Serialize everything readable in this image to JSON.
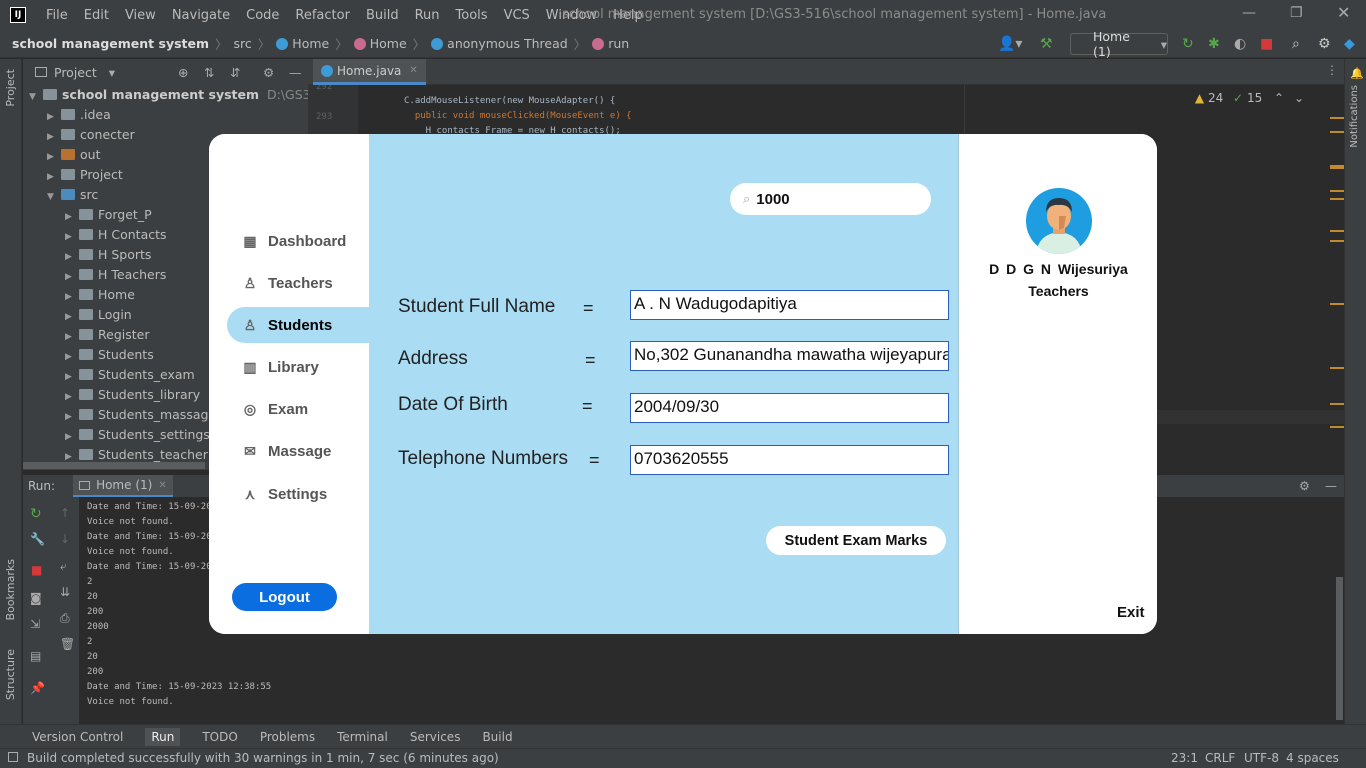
{
  "ide": {
    "logo": "IJ",
    "menu": [
      "File",
      "Edit",
      "View",
      "Navigate",
      "Code",
      "Refactor",
      "Build",
      "Run",
      "Tools",
      "VCS",
      "Window",
      "Help"
    ],
    "window_title": "school management system [D:\\GS3-516\\school management system] - Home.java",
    "breadcrumbs": [
      "school management system",
      "src",
      "Home",
      "Home",
      "anonymous Thread",
      "run"
    ],
    "run_config": "Home (1)",
    "project_label": "Project",
    "editor_tab": "Home.java",
    "warnings": "24",
    "weak_warnings": "15",
    "tree": [
      {
        "label": "school management system",
        "extra": "D:\\GS3-516\\sch",
        "level": 0,
        "open": true
      },
      {
        "label": ".idea",
        "level": 1
      },
      {
        "label": "conecter",
        "level": 1
      },
      {
        "label": "out",
        "level": 1
      },
      {
        "label": "Project",
        "level": 1
      },
      {
        "label": "src",
        "level": 1,
        "open": true
      },
      {
        "label": "Forget_P",
        "level": 2
      },
      {
        "label": "H Contacts",
        "level": 2
      },
      {
        "label": "H Sports",
        "level": 2
      },
      {
        "label": "H Teachers",
        "level": 2
      },
      {
        "label": "Home",
        "level": 2
      },
      {
        "label": "Login",
        "level": 2
      },
      {
        "label": "Register",
        "level": 2
      },
      {
        "label": "Students",
        "level": 2
      },
      {
        "label": "Students_exam",
        "level": 2
      },
      {
        "label": "Students_library",
        "level": 2
      },
      {
        "label": "Students_massage",
        "level": 2
      },
      {
        "label": "Students_settings",
        "level": 2
      },
      {
        "label": "Students_teacher",
        "level": 2
      }
    ],
    "code_lines": [
      {
        "num": "292",
        "text": "C.addMouseListener(new MouseAdapter() {"
      },
      {
        "num": "293",
        "text": "  public void mouseClicked(MouseEvent e) {"
      },
      {
        "num": "294",
        "text": "    H_contacts Frame = new H_contacts();"
      }
    ],
    "run_label": "Run:",
    "run_tab": "Home (1)",
    "console_lines": [
      "Date and Time: 15-09-202",
      "Voice not found.",
      "Date and Time: 15-09-202",
      "Voice not found.",
      "Date and Time: 15-09-202",
      "2",
      "20",
      "200",
      "2000",
      "2",
      "20",
      "200",
      "Date and Time: 15-09-2023 12:38:55",
      "Voice not found."
    ],
    "bottom_tools": [
      "Version Control",
      "Run",
      "TODO",
      "Problems",
      "Terminal",
      "Services",
      "Build"
    ],
    "status_message": "Build completed successfully with 30 warnings in 1 min, 7 sec (6 minutes ago)",
    "status_right": [
      "23:1",
      "CRLF",
      "UTF-8",
      "4 spaces"
    ],
    "left_strip": [
      "Project",
      "Bookmarks",
      "Structure"
    ],
    "right_strip": [
      "Notifications"
    ]
  },
  "app": {
    "nav": [
      {
        "label": "Dashboard",
        "icon": "dashboard-icon"
      },
      {
        "label": "Teachers",
        "icon": "teacher-icon"
      },
      {
        "label": "Students",
        "icon": "student-icon",
        "active": true
      },
      {
        "label": "Library",
        "icon": "library-icon"
      },
      {
        "label": "Exam",
        "icon": "exam-icon"
      },
      {
        "label": "Massage",
        "icon": "mail-icon"
      },
      {
        "label": "Settings",
        "icon": "settings-icon"
      }
    ],
    "logout": "Logout",
    "search_value": "1000",
    "fields": [
      {
        "label": "Student Full Name",
        "eq": "=",
        "value": "A . N Wadugodapitiya"
      },
      {
        "label": "Address",
        "eq": "=",
        "value": "No,302 Gunanandha mawatha wijeyapura"
      },
      {
        "label": "Date Of Birth",
        "eq": "=",
        "value": "2004/09/30"
      },
      {
        "label": "Telephone Numbers",
        "eq": "=",
        "value": "0703620555"
      }
    ],
    "exam_button": "Student Exam Marks",
    "user_name": "D D G N  Wijesuriya",
    "user_role": "Teachers",
    "exit": "Exit",
    "colors": {
      "main_bg": "#aadcf3",
      "logout_bg": "#0b6ee0",
      "avatar_bg": "#1e9ee0"
    }
  }
}
